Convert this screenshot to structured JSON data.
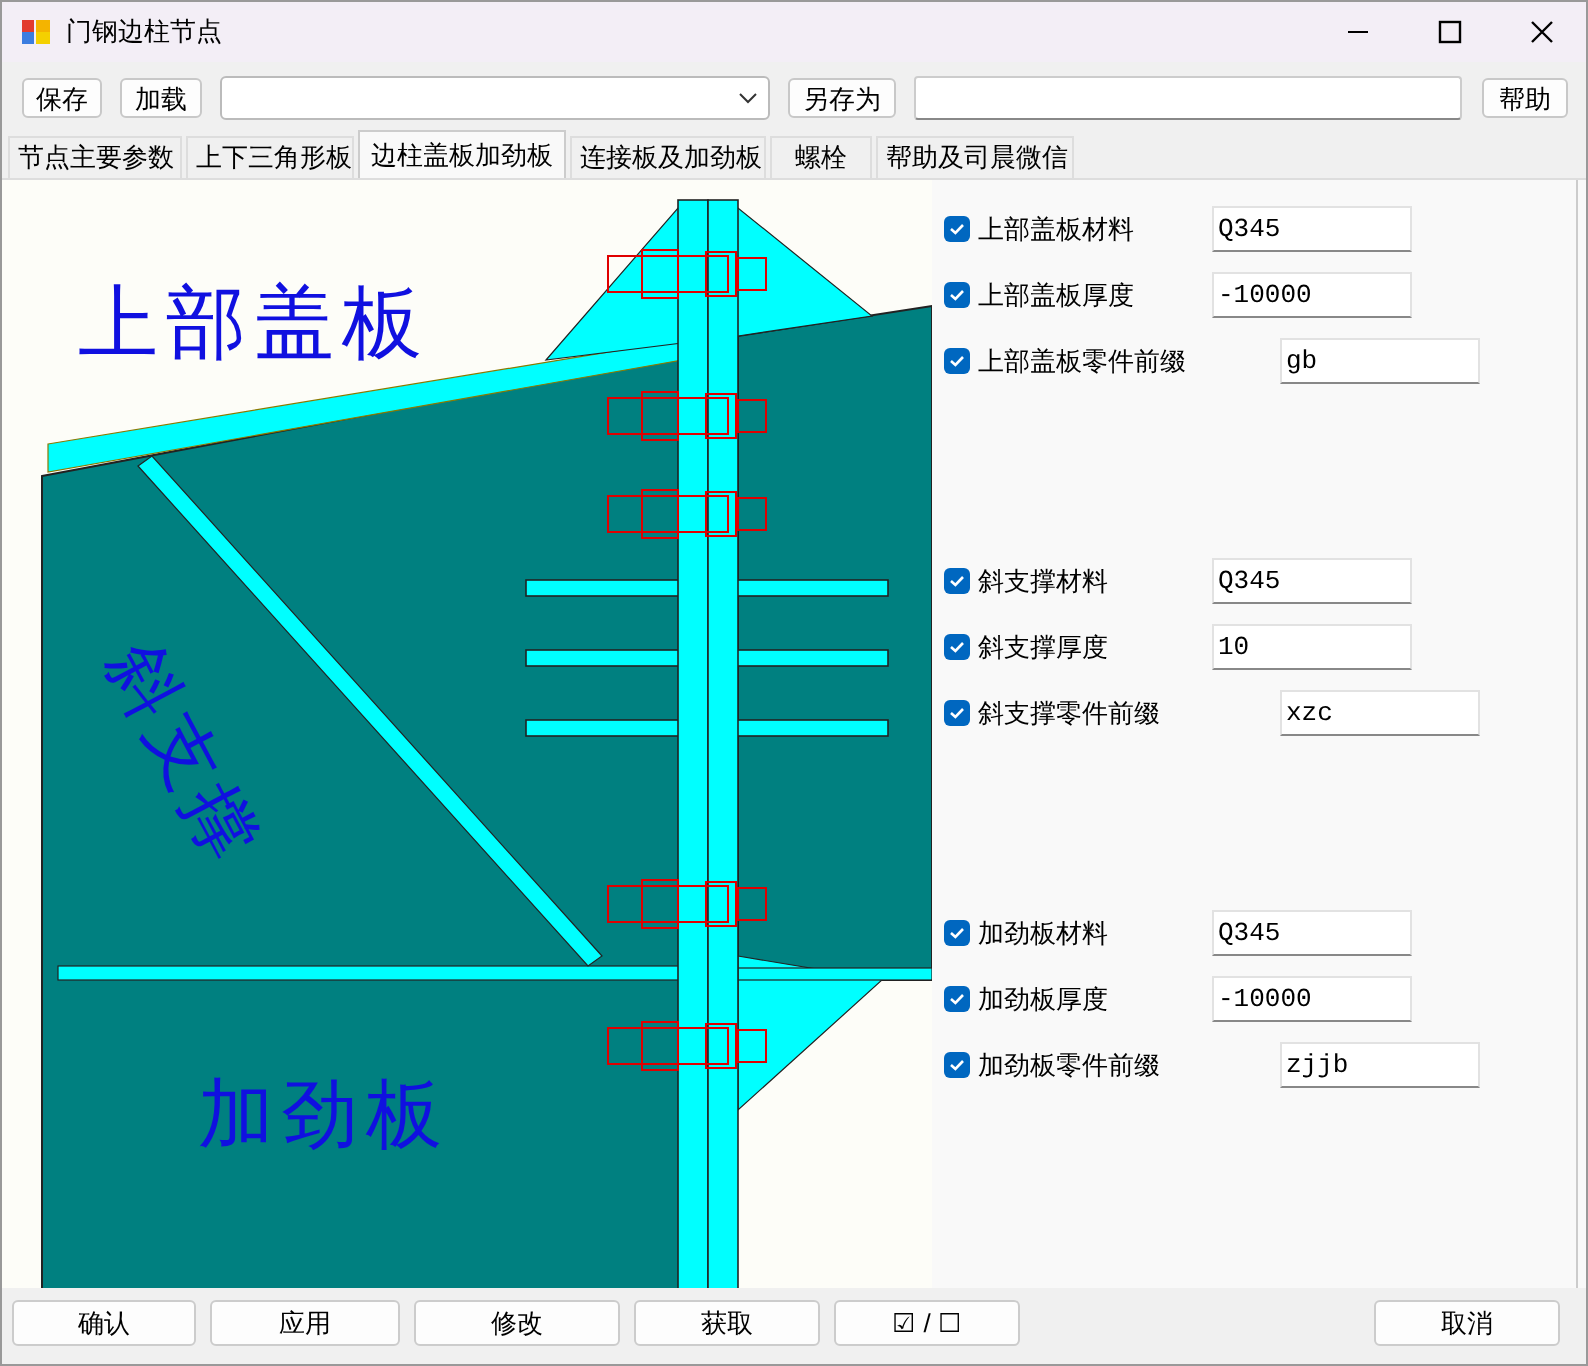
{
  "window": {
    "title": "门钢边柱节点"
  },
  "toolbar": {
    "save": "保存",
    "load": "加载",
    "save_as": "另存为",
    "help": "帮助"
  },
  "tabs": [
    {
      "label": "节点主要参数",
      "selected": false
    },
    {
      "label": "上下三角形板",
      "selected": false
    },
    {
      "label": "边柱盖板加劲板",
      "selected": true
    },
    {
      "label": "连接板及加劲板",
      "selected": false
    },
    {
      "label": "螺栓",
      "selected": false
    },
    {
      "label": "帮助及司晨微信",
      "selected": false
    }
  ],
  "diagram": {
    "labels": [
      "上部盖板",
      "斜支撑",
      "加劲板"
    ]
  },
  "groups": [
    {
      "rows": [
        {
          "kind": "material",
          "label": "上部盖板材料",
          "checked": true,
          "value": "Q345"
        },
        {
          "kind": "thickness",
          "label": "上部盖板厚度",
          "checked": true,
          "value": "-10000"
        },
        {
          "kind": "prefix",
          "label": "上部盖板零件前缀",
          "checked": true,
          "value": "gb"
        }
      ]
    },
    {
      "rows": [
        {
          "kind": "material",
          "label": "斜支撑材料",
          "checked": true,
          "value": "Q345"
        },
        {
          "kind": "thickness",
          "label": "斜支撑厚度",
          "checked": true,
          "value": "10"
        },
        {
          "kind": "prefix",
          "label": "斜支撑零件前缀",
          "checked": true,
          "value": "xzc"
        }
      ]
    },
    {
      "rows": [
        {
          "kind": "material",
          "label": "加劲板材料",
          "checked": true,
          "value": "Q345"
        },
        {
          "kind": "thickness",
          "label": "加劲板厚度",
          "checked": true,
          "value": "-10000"
        },
        {
          "kind": "prefix",
          "label": "加劲板零件前缀",
          "checked": true,
          "value": "zjjb"
        }
      ]
    }
  ],
  "bottom_buttons": [
    "确认",
    "应用",
    "修改",
    "获取",
    "☑ / ☐"
  ],
  "cancel": "取消"
}
